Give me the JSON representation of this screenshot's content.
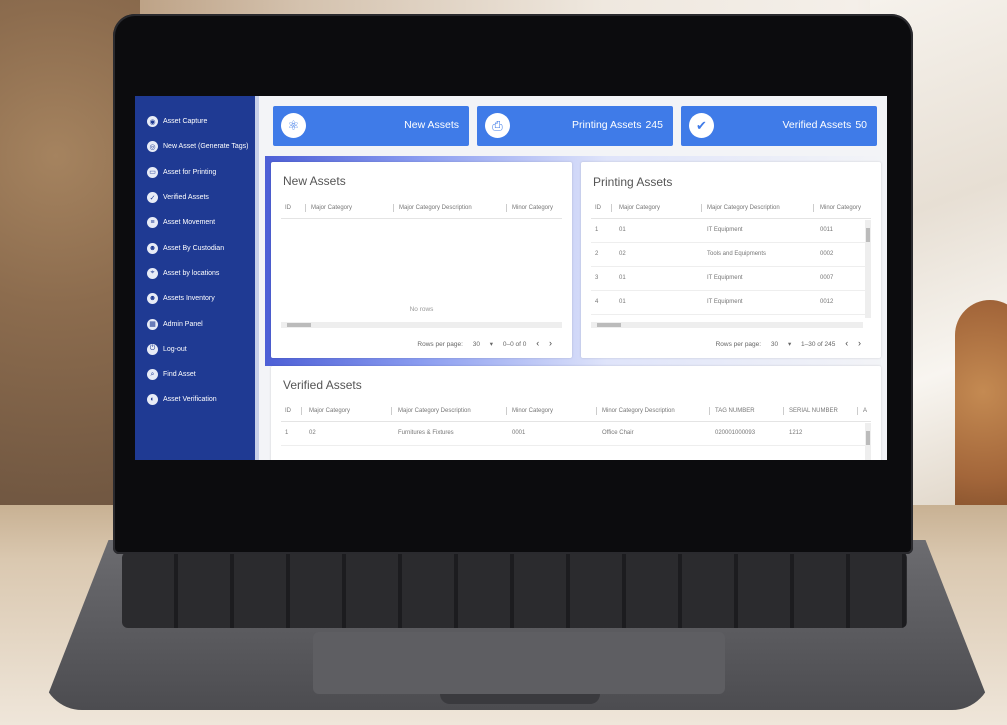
{
  "sidebar": {
    "items": [
      {
        "label": "Asset Capture",
        "icon": "capture-icon"
      },
      {
        "label": "New Asset (Generate Tags)",
        "icon": "tag-icon"
      },
      {
        "label": "Asset for Printing",
        "icon": "printer-icon"
      },
      {
        "label": "Verified Assets",
        "icon": "verified-icon"
      },
      {
        "label": "Asset Movement",
        "icon": "movement-icon"
      },
      {
        "label": "Asset By Custodian",
        "icon": "custodian-icon"
      },
      {
        "label": "Asset by locations",
        "icon": "location-icon"
      },
      {
        "label": "Assets Inventory",
        "icon": "inventory-icon"
      },
      {
        "label": "Admin Panel",
        "icon": "admin-icon"
      },
      {
        "label": "Log-out",
        "icon": "logout-icon"
      },
      {
        "label": "Find Asset",
        "icon": "find-icon"
      },
      {
        "label": "Asset Verification",
        "icon": "verification-icon"
      }
    ]
  },
  "cards": {
    "new": {
      "label": "New Assets",
      "count": "",
      "icon": "atom-icon"
    },
    "printing": {
      "label": "Printing Assets",
      "count": "245",
      "icon": "printer-icon"
    },
    "verified": {
      "label": "Verified Assets",
      "count": "50",
      "icon": "verified-doc-icon"
    }
  },
  "new_assets": {
    "title": "New Assets",
    "columns": [
      "ID",
      "Major Category",
      "Major Category Description",
      "Minor Category"
    ],
    "empty_text": "No rows",
    "rows_per_page_label": "Rows per page:",
    "rows_per_page": "30",
    "range": "0–0 of 0"
  },
  "printing_assets": {
    "title": "Printing Assets",
    "columns": [
      "ID",
      "Major Category",
      "Major Category Description",
      "Minor Category"
    ],
    "rows": [
      [
        "1",
        "01",
        "IT Equipment",
        "0011"
      ],
      [
        "2",
        "02",
        "Tools and Equipments",
        "0002"
      ],
      [
        "3",
        "01",
        "IT Equipment",
        "0007"
      ],
      [
        "4",
        "01",
        "IT Equipment",
        "0012"
      ]
    ],
    "rows_per_page_label": "Rows per page:",
    "rows_per_page": "30",
    "range": "1–30 of 245"
  },
  "verified_assets": {
    "title": "Verified Assets",
    "columns": [
      "ID",
      "Major Category",
      "Major Category Description",
      "Minor Category",
      "Minor Category Description",
      "TAG NUMBER",
      "SERIAL NUMBER",
      "A"
    ],
    "rows": [
      [
        "1",
        "02",
        "Furnitures & Fixtures",
        "0001",
        "Office Chair",
        "020001000093",
        "1212"
      ]
    ]
  }
}
